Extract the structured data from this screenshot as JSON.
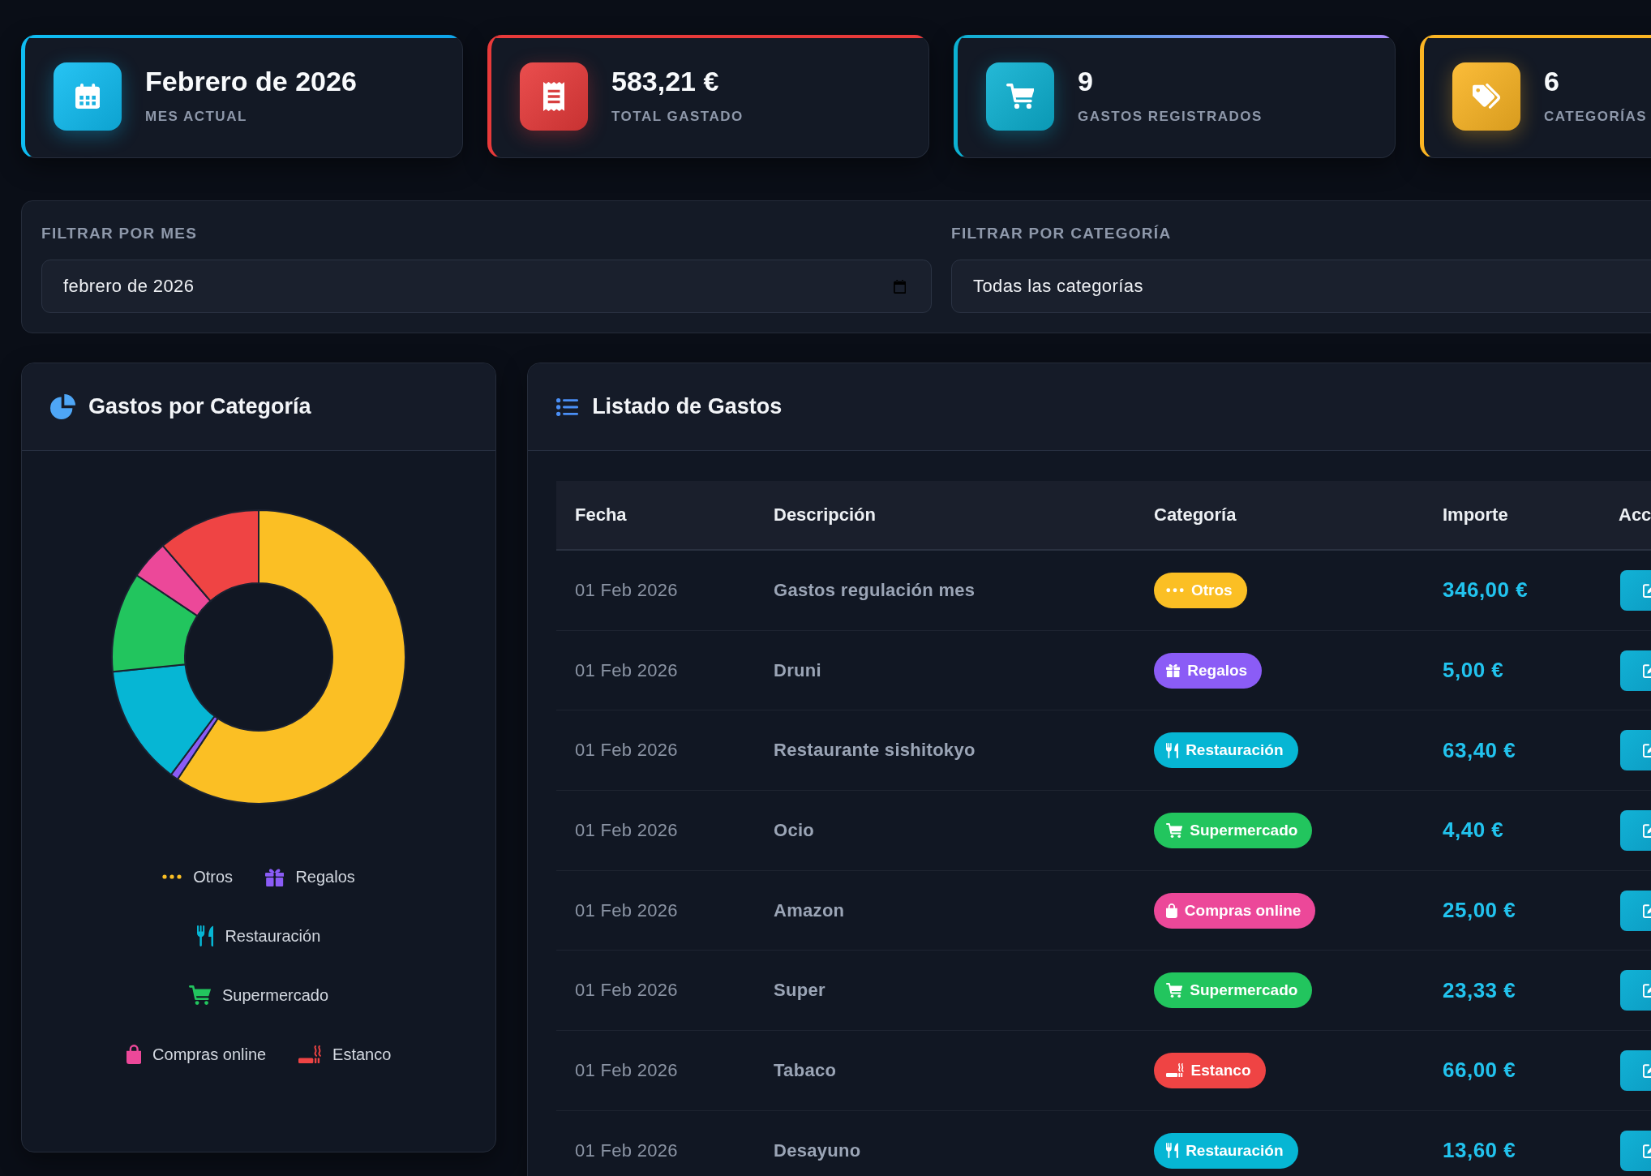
{
  "stats": [
    {
      "kind": "calendar",
      "value": "Febrero de 2026",
      "label": "MES ACTUAL",
      "color": "#0fbdf2",
      "gradient_end": {
        "color": "#0ea5e9"
      }
    },
    {
      "kind": "receipt",
      "value": "583,21 €",
      "label": "TOTAL GASTADO",
      "color": "#e83a3a"
    },
    {
      "kind": "cart",
      "value": "9",
      "label": "GASTOS REGISTRADOS",
      "color": "#0cb1d2",
      "gradient_end": {
        "color": "#a78bfa"
      }
    },
    {
      "kind": "tags",
      "value": "6",
      "label": "CATEGORÍAS",
      "color": "#fbb523"
    }
  ],
  "filters": [
    {
      "kind": "date",
      "label": "FILTRAR POR MES",
      "value": "febrero de 2026"
    },
    {
      "kind": "select",
      "label": "FILTRAR POR CATEGORÍA",
      "value": "Todas las categorías"
    }
  ],
  "chart_panel": {
    "title": "Gastos por Categoría",
    "legend": [
      {
        "kind": "dots",
        "label": "Otros",
        "color": "#fbbf24"
      },
      {
        "kind": "gift",
        "label": "Regalos",
        "color": "#8b5cf6"
      },
      {
        "kind": "utensils",
        "label": "Restauración",
        "color": "#06b6d4"
      },
      {
        "kind": "cart",
        "label": "Supermercado",
        "color": "#22c55e"
      },
      {
        "kind": "bag",
        "label": "Compras online",
        "color": "#ec4899"
      },
      {
        "kind": "smoking",
        "label": "Estanco",
        "color": "#ef4444"
      }
    ]
  },
  "expenses_panel": {
    "title": "Listado de Gastos",
    "columns": [
      "Fecha",
      "Descripción",
      "Categoría",
      "Importe",
      "Acc"
    ],
    "rows": [
      {
        "date": "01 Feb 2026",
        "description": "Gastos regulación mes",
        "category": {
          "kind": "dots",
          "label": "Otros",
          "color": "#fbbf24"
        },
        "amount": "346,00 €"
      },
      {
        "date": "01 Feb 2026",
        "description": "Druni",
        "category": {
          "kind": "gift",
          "label": "Regalos",
          "color": "#8b5cf6"
        },
        "amount": "5,00 €"
      },
      {
        "date": "01 Feb 2026",
        "description": "Restaurante sishitokyo",
        "category": {
          "kind": "utensils",
          "label": "Restauración",
          "color": "#06b6d4"
        },
        "amount": "63,40 €"
      },
      {
        "date": "01 Feb 2026",
        "description": "Ocio",
        "category": {
          "kind": "cart",
          "label": "Supermercado",
          "color": "#22c55e"
        },
        "amount": "4,40 €"
      },
      {
        "date": "01 Feb 2026",
        "description": "Amazon",
        "category": {
          "kind": "bag",
          "label": "Compras online",
          "color": "#ec4899"
        },
        "amount": "25,00 €"
      },
      {
        "date": "01 Feb 2026",
        "description": "Super",
        "category": {
          "kind": "cart",
          "label": "Supermercado",
          "color": "#22c55e"
        },
        "amount": "23,33 €"
      },
      {
        "date": "01 Feb 2026",
        "description": "Tabaco",
        "category": {
          "kind": "smoking",
          "label": "Estanco",
          "color": "#ef4444"
        },
        "amount": "66,00 €"
      },
      {
        "date": "01 Feb 2026",
        "description": "Desayuno",
        "category": {
          "kind": "utensils",
          "label": "Restauración",
          "color": "#06b6d4"
        },
        "amount": "13,60 €"
      }
    ]
  }
}
